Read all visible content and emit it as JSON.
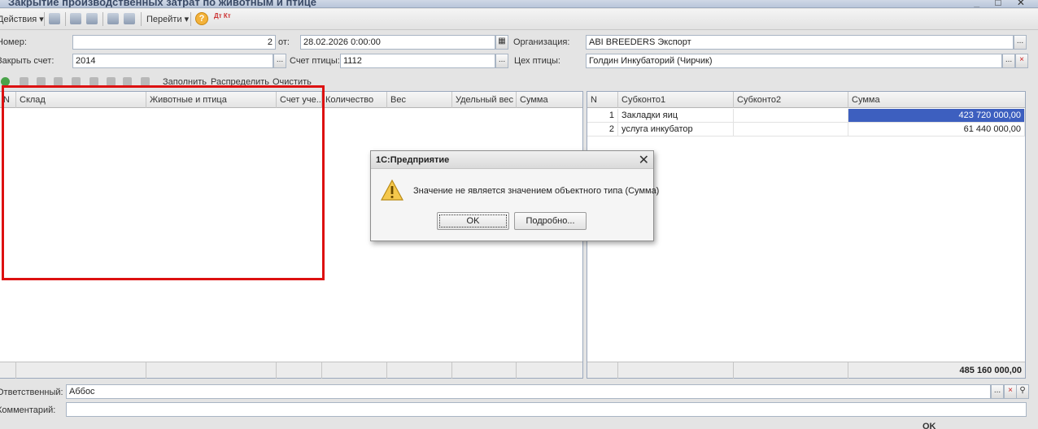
{
  "window": {
    "title": "Закрытие производственных затрат по животным и птице",
    "controls": "_ □ ✕"
  },
  "toolbar": {
    "actions_label": "Действия ▾",
    "goto_label": "Перейти ▾",
    "help_label": "?",
    "dt_kt_label": "Дт Кт"
  },
  "form": {
    "number_label": "Номер:",
    "number_value": "2",
    "from_label": "от:",
    "date_value": "28.02.2026 0:00:00",
    "org_label": "Организация:",
    "org_value": "ABI BREEDERS Экспорт",
    "close_account_label": "Закрыть счет:",
    "close_account_value": "2014",
    "bird_account_label": "Счет птицы:",
    "bird_account_value": "1112",
    "workshop_label": "Цех птицы:",
    "workshop_value": "Голдин Инкубаторий (Чирчик)",
    "ellipsis": "...",
    "clear": "×",
    "responsible_label": "Ответственный:",
    "responsible_value": "Аббос",
    "comment_label": "Комментарий:",
    "comment_value": ""
  },
  "left_table": {
    "toolbar": {
      "fill": "Заполнить",
      "distribute": "Распределить",
      "clear": "Очистить"
    },
    "columns": [
      "N",
      "Склад",
      "Животные и птица",
      "Счет уче...",
      "Количество",
      "Вес",
      "Удельный вес",
      "Сумма"
    ]
  },
  "right_table": {
    "columns": [
      "N",
      "Субконто1",
      "Субконто2",
      "Сумма"
    ],
    "rows": [
      {
        "n": "1",
        "subconto1": "Закладки яиц",
        "subconto2": "",
        "sum": "423 720 000,00"
      },
      {
        "n": "2",
        "subconto1": "услуга инкубатор",
        "subconto2": "",
        "sum": "61 440 000,00"
      }
    ],
    "total": "485 160 000,00"
  },
  "dialog": {
    "title": "1С:Предприятие",
    "message": "Значение не является значением объектного типа (Сумма)",
    "ok_label": "OK",
    "details_label": "Подробно...",
    "close": "✕"
  },
  "status": {
    "text": "OK"
  }
}
